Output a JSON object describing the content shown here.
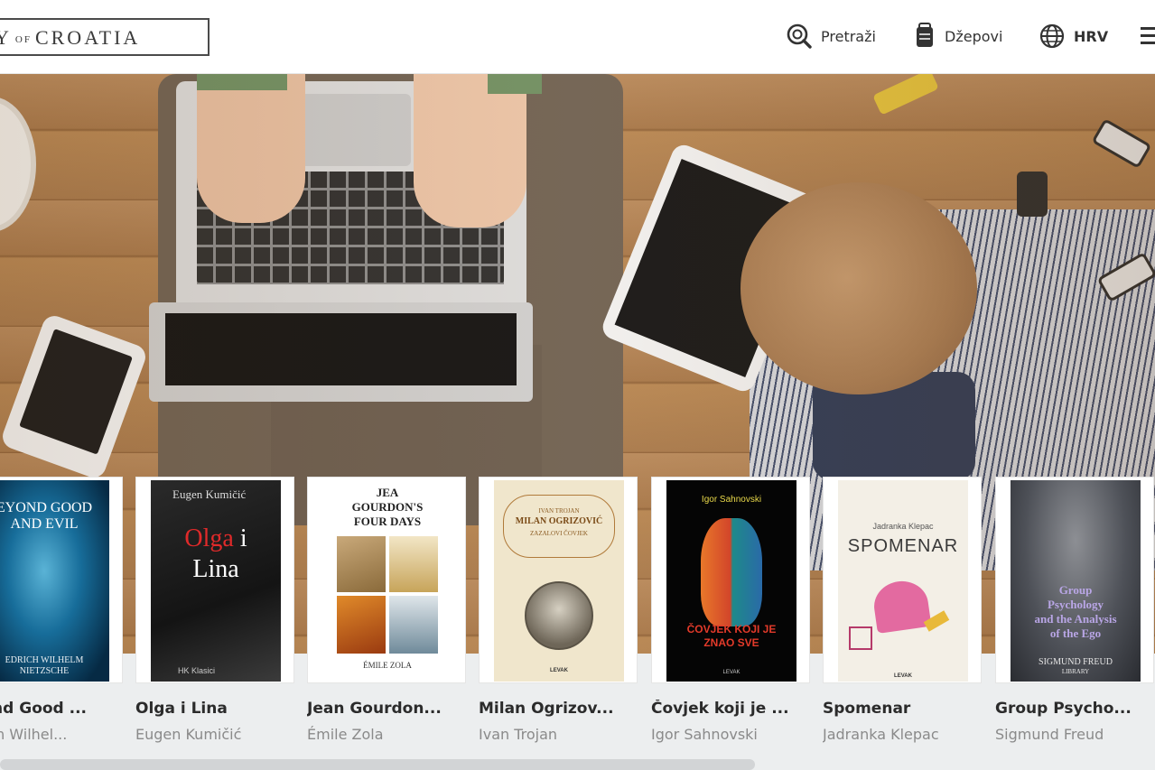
{
  "header": {
    "logo": {
      "prefix": "Y",
      "of": "OF",
      "main": "CROATIA"
    },
    "nav": {
      "search_label": "Pretraži",
      "pockets_label": "Džepovi",
      "language_label": "HRV"
    }
  },
  "books": [
    {
      "title": "...ond Good ...",
      "author": "...rich Wilhel...",
      "cover_lines": [
        "EYOND GOOD",
        "AND EVIL"
      ],
      "cover_footer": "EDRICH WILHELM NIETZSCHE"
    },
    {
      "title": "Olga i Lina",
      "author": "Eugen Kumičić",
      "cover_author": "Eugen Kumičić",
      "cover_title_1": "Olga",
      "cover_title_2": "i",
      "cover_title_3": "Lina",
      "cover_footer": "HK Klasici"
    },
    {
      "title": "Jean Gourdon...",
      "author": "Émile Zola",
      "cover_title_1": "JEA",
      "cover_title_2": "GOURDON'S",
      "cover_title_3": "FOUR DAYS",
      "cover_footer": "ÉMILE ZOLA"
    },
    {
      "title": "Milan Ogrizov...",
      "author": "Ivan Trojan",
      "cover_author": "IVAN TROJAN",
      "cover_title": "MILAN OGRIZOVIĆ",
      "cover_sub": "ZAZALOVI ČOVJEK",
      "cover_footer": "LEVAK"
    },
    {
      "title": "Čovjek koji je ...",
      "author": "Igor Sahnovski",
      "cover_author": "Igor Sahnovski",
      "cover_title_1": "ČOVJEK KOJI JE",
      "cover_title_2": "ZNAO SVE",
      "cover_footer": "LEVAK"
    },
    {
      "title": "Spomenar",
      "author": "Jadranka Klepac",
      "cover_author": "Jadranka Klepac",
      "cover_title": "SPOMENAR",
      "cover_footer": "LEVAK"
    },
    {
      "title": "Group Psycho...",
      "author": "Sigmund Freud",
      "cover_title_1": "Group",
      "cover_title_2": "Psychology",
      "cover_title_3": "and the Analysis",
      "cover_title_4": "of the Ego",
      "cover_footer": "SIGMUND FREUD",
      "cover_footer_2": "LIBRARY"
    }
  ],
  "colors": {
    "header_bg": "#ffffff",
    "shelf_bg": "#eceeef",
    "title_text": "#2b2b2b",
    "author_text": "#8a8a8a"
  }
}
